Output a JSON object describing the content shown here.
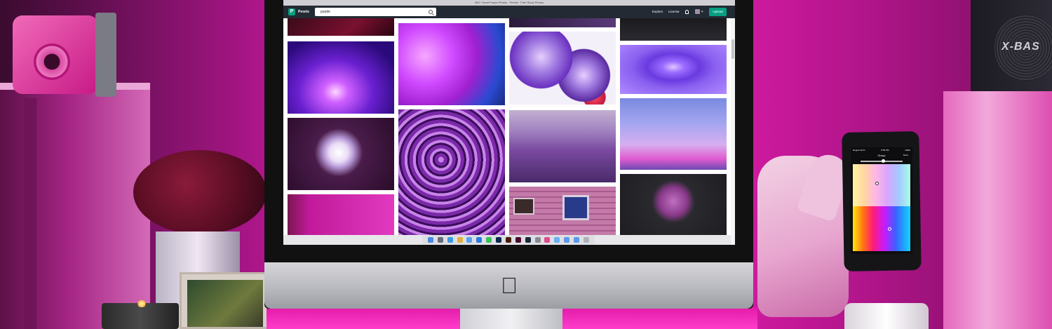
{
  "browser": {
    "title": "300+ Great Purple Photos · Pexels · Free Stock Photos"
  },
  "pexels": {
    "brand": "Pexels",
    "logo_letter": "P",
    "search_value": "purple",
    "nav": {
      "explore": "Explore",
      "license": "License",
      "upload": "Upload"
    }
  },
  "icons": {
    "search": "search-icon",
    "bell": "bell-icon",
    "chevron": "chevron-down-icon",
    "apple": "apple-logo"
  },
  "phone": {
    "status_left": "Rogers Wi-Fi",
    "status_time": "8:59 PM",
    "status_right": "100%",
    "title": "Group",
    "done": "Done"
  },
  "speaker": {
    "label": "X-BAS"
  },
  "colors": {
    "pexels_green": "#05a081",
    "header_dark": "#232a33",
    "ambient_magenta": "#c2148f"
  }
}
